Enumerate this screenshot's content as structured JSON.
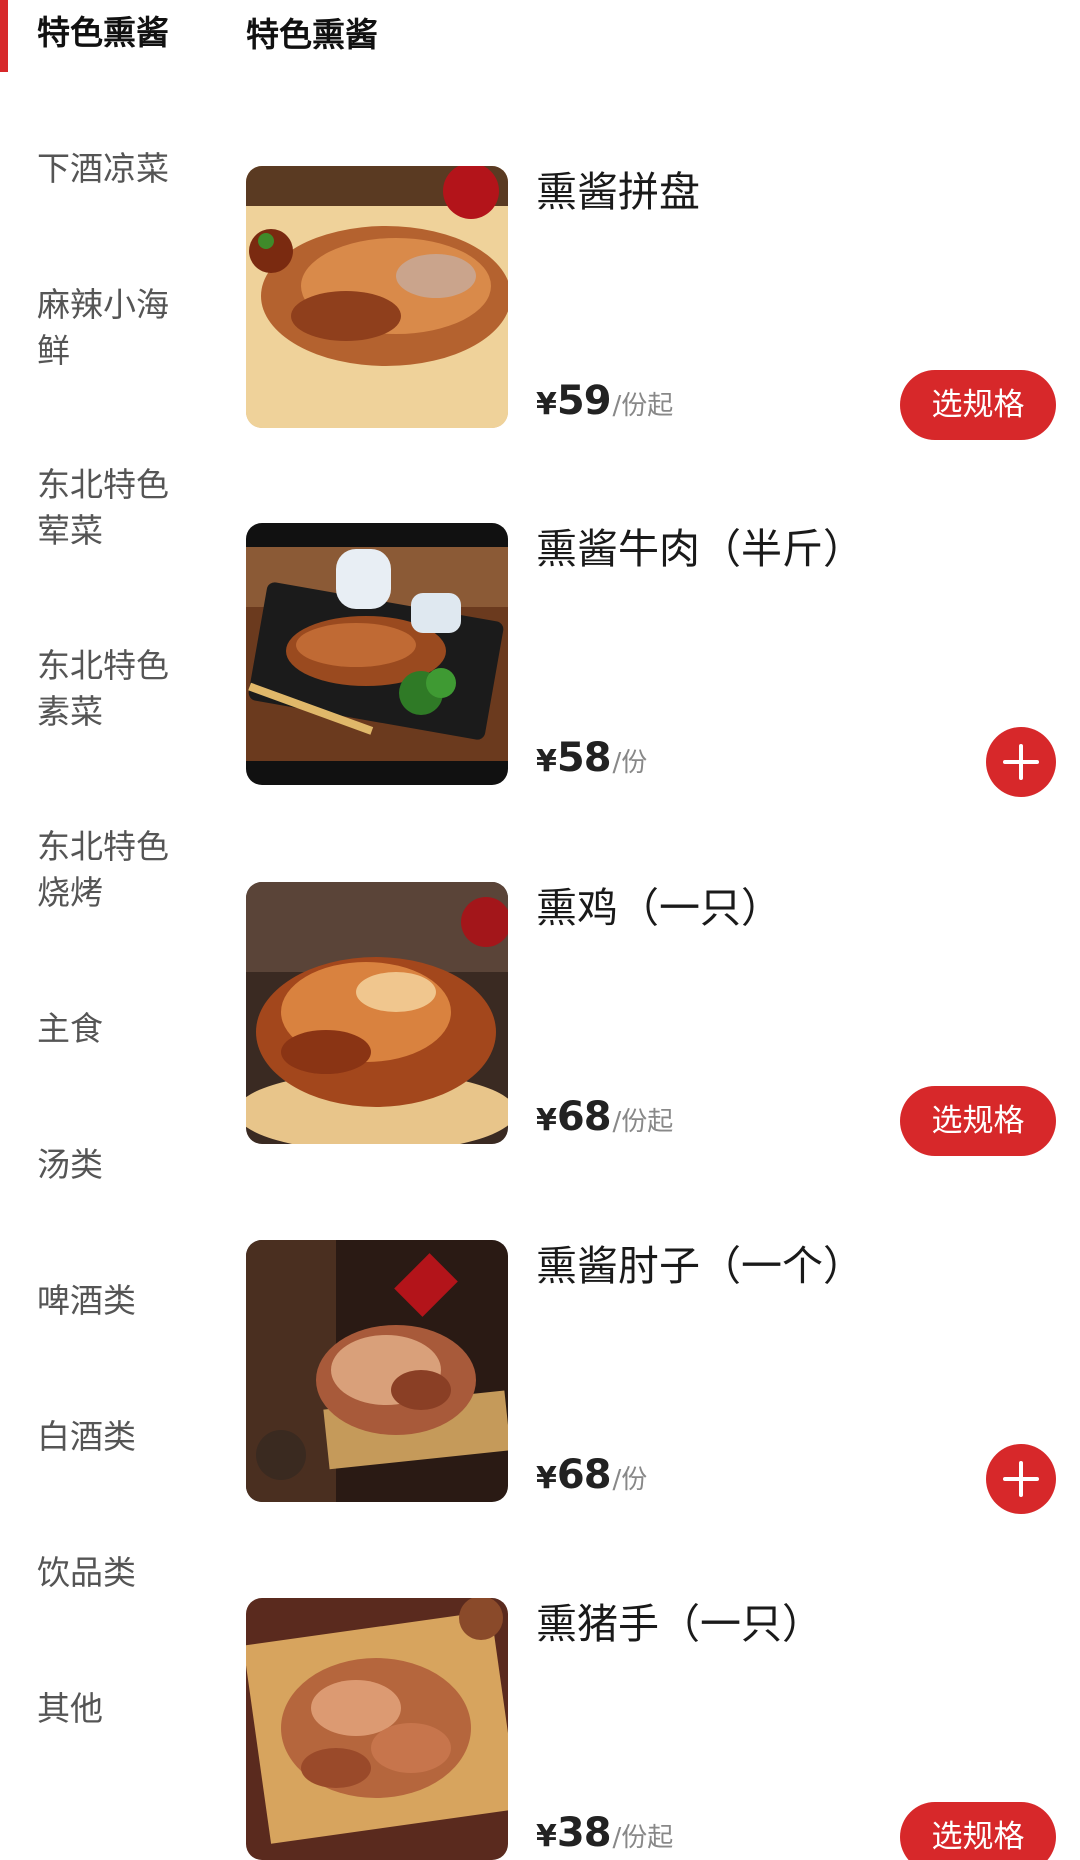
{
  "sidebar": {
    "items": [
      {
        "label": "特色熏酱",
        "active": true
      },
      {
        "label": "下酒凉菜"
      },
      {
        "label": "麻辣小海鲜"
      },
      {
        "label": "东北特色荤菜"
      },
      {
        "label": "东北特色素菜"
      },
      {
        "label": "东北特色烧烤"
      },
      {
        "label": "主食"
      },
      {
        "label": "汤类"
      },
      {
        "label": "啤酒类"
      },
      {
        "label": "白酒类"
      },
      {
        "label": "饮品类"
      },
      {
        "label": "其他"
      }
    ]
  },
  "section": {
    "title": "特色熏酱"
  },
  "products": [
    {
      "name": "熏酱拼盘",
      "currency": "¥",
      "price": "59",
      "unit": "/份起",
      "action": "选规格"
    },
    {
      "name": "熏酱牛肉（半斤）",
      "currency": "¥",
      "price": "58",
      "unit": "/份",
      "action": "add"
    },
    {
      "name": "熏鸡（一只）",
      "currency": "¥",
      "price": "68",
      "unit": "/份起",
      "action": "选规格"
    },
    {
      "name": "熏酱肘子（一个）",
      "currency": "¥",
      "price": "68",
      "unit": "/份",
      "action": "add"
    },
    {
      "name": "熏猪手（一只）",
      "currency": "¥",
      "price": "38",
      "unit": "/份起",
      "action": "选规格"
    }
  ],
  "colors": {
    "accent": "#d7282a"
  }
}
